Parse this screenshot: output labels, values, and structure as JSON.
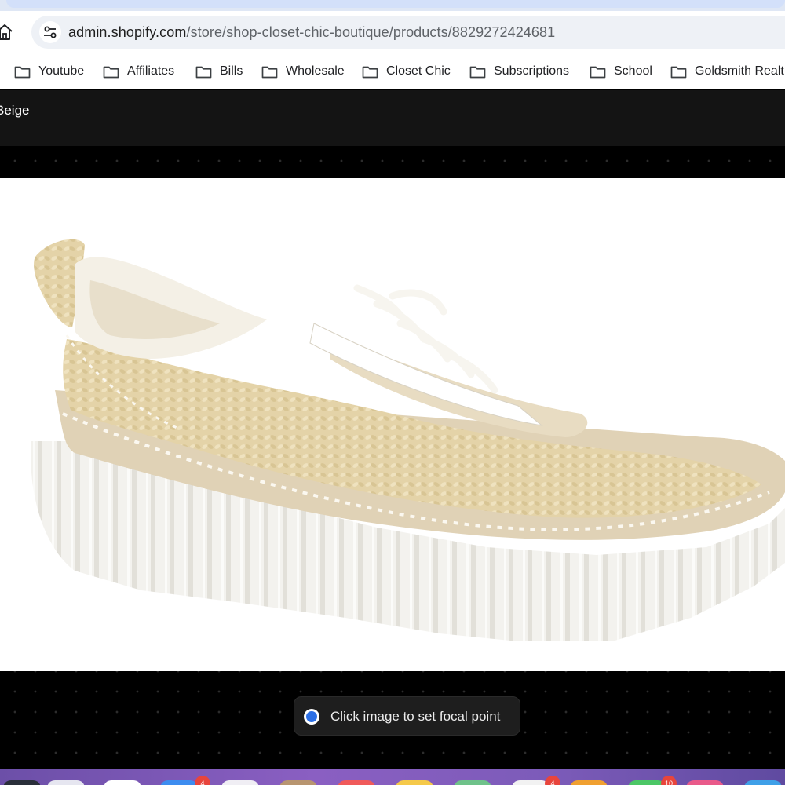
{
  "browser": {
    "url_host": "admin.shopify.com",
    "url_path": "/store/shop-closet-chic-boutique/products/8829272424681"
  },
  "bookmarks": [
    {
      "label": "Youtube",
      "icon": "folder-icon"
    },
    {
      "label": "Affiliates",
      "icon": "folder-icon"
    },
    {
      "label": "Bills",
      "icon": "folder-icon"
    },
    {
      "label": "Wholesale",
      "icon": "folder-icon"
    },
    {
      "label": "Closet Chic",
      "icon": "folder-icon"
    },
    {
      "label": "Subscriptions",
      "icon": "folder-icon"
    },
    {
      "label": "School",
      "icon": "folder-icon"
    },
    {
      "label": "Goldsmith Realt",
      "icon": "folder-icon"
    }
  ],
  "editor": {
    "title": "Beige",
    "focal_hint": "Click image to set focal point"
  },
  "colors": {
    "header_bg": "#141414",
    "canvas_bg": "#000000",
    "focal_accent": "#2b6fe6",
    "dock_badge": "#e8453c"
  },
  "dock": {
    "badges": [
      "4",
      "4",
      "10"
    ]
  }
}
